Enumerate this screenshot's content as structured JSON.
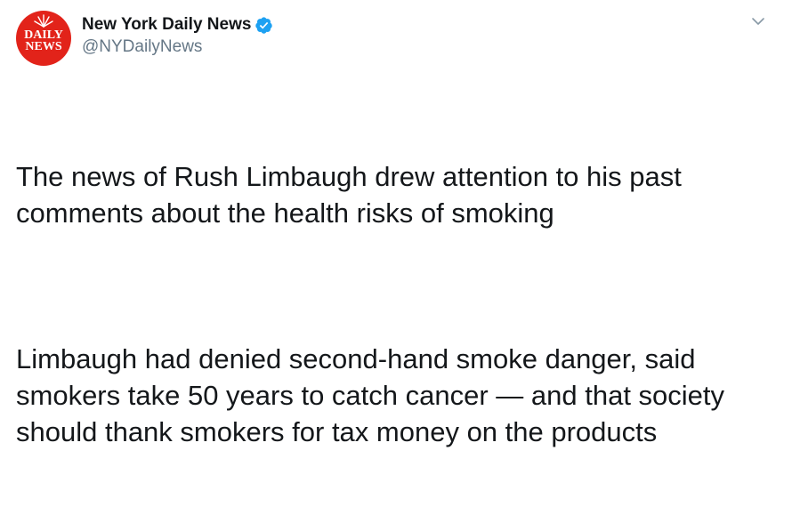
{
  "account": {
    "display_name": "New York Daily News",
    "handle": "@NYDailyNews",
    "verified": true,
    "avatar_logo_line1": "DAILY",
    "avatar_logo_line2": "NEWS",
    "avatar_color": "#e2231a"
  },
  "icons": {
    "verified": "verified-badge-icon",
    "menu": "chevron-down-icon"
  },
  "tweet": {
    "paragraph_1": "The news of Rush Limbaugh drew attention to his past comments about the health risks of smoking",
    "paragraph_2": "Limbaugh had denied second-hand smoke danger, said smokers take 50 years to catch cancer — and that society should thank smokers for tax money on the products"
  },
  "colors": {
    "text": "#14171a",
    "secondary_text": "#657786",
    "verified_blue": "#1da1f2"
  }
}
